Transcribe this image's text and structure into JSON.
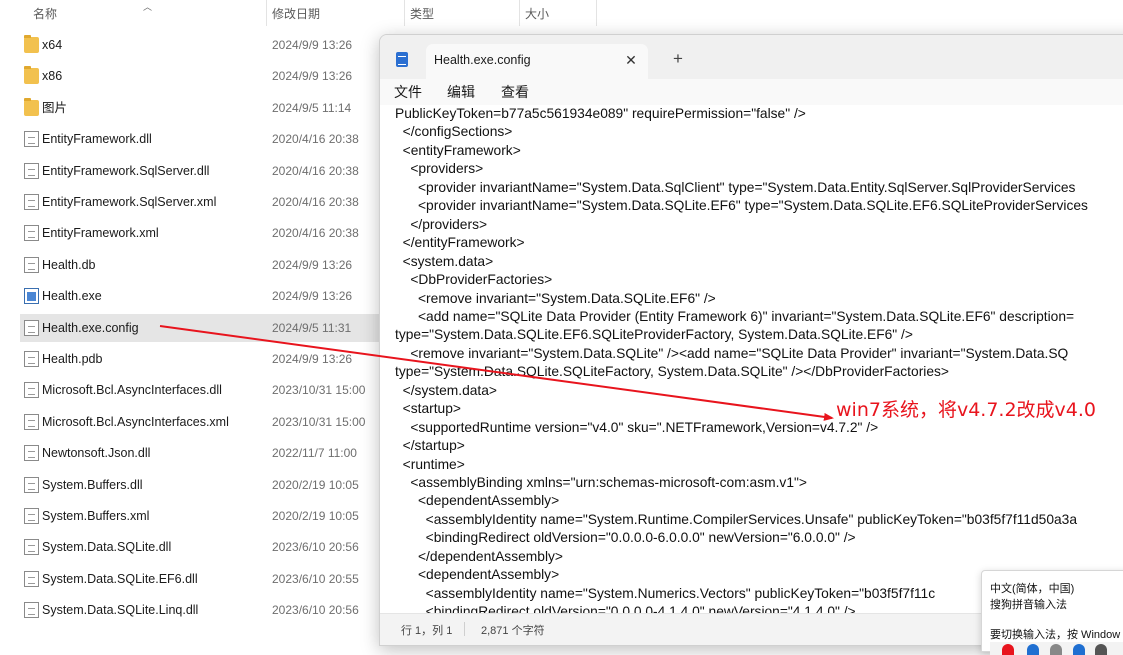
{
  "explorer": {
    "columns": {
      "name": "名称",
      "modified": "修改日期",
      "type": "类型",
      "size": "大小"
    },
    "files": [
      {
        "name": "x64",
        "date": "2024/9/9 13:26",
        "kind": "folder"
      },
      {
        "name": "x86",
        "date": "2024/9/9 13:26",
        "kind": "folder"
      },
      {
        "name": "图片",
        "date": "2024/9/5 11:14",
        "kind": "folder"
      },
      {
        "name": "EntityFramework.dll",
        "date": "2020/4/16 20:38",
        "kind": "file"
      },
      {
        "name": "EntityFramework.SqlServer.dll",
        "date": "2020/4/16 20:38",
        "kind": "file"
      },
      {
        "name": "EntityFramework.SqlServer.xml",
        "date": "2020/4/16 20:38",
        "kind": "file"
      },
      {
        "name": "EntityFramework.xml",
        "date": "2020/4/16 20:38",
        "kind": "file"
      },
      {
        "name": "Health.db",
        "date": "2024/9/9 13:26",
        "kind": "file"
      },
      {
        "name": "Health.exe",
        "date": "2024/9/9 13:26",
        "kind": "exe"
      },
      {
        "name": "Health.exe.config",
        "date": "2024/9/5 11:31",
        "kind": "file",
        "selected": true
      },
      {
        "name": "Health.pdb",
        "date": "2024/9/9 13:26",
        "kind": "file"
      },
      {
        "name": "Microsoft.Bcl.AsyncInterfaces.dll",
        "date": "2023/10/31 15:00",
        "kind": "file"
      },
      {
        "name": "Microsoft.Bcl.AsyncInterfaces.xml",
        "date": "2023/10/31 15:00",
        "kind": "file"
      },
      {
        "name": "Newtonsoft.Json.dll",
        "date": "2022/11/7 11:00",
        "kind": "file"
      },
      {
        "name": "System.Buffers.dll",
        "date": "2020/2/19 10:05",
        "kind": "file"
      },
      {
        "name": "System.Buffers.xml",
        "date": "2020/2/19 10:05",
        "kind": "file"
      },
      {
        "name": "System.Data.SQLite.dll",
        "date": "2023/6/10 20:56",
        "kind": "file"
      },
      {
        "name": "System.Data.SQLite.EF6.dll",
        "date": "2023/6/10 20:55",
        "kind": "file"
      },
      {
        "name": "System.Data.SQLite.Linq.dll",
        "date": "2023/6/10 20:56",
        "kind": "file"
      }
    ]
  },
  "notepad": {
    "tab_title": "Health.exe.config",
    "close_glyph": "✕",
    "new_tab_glyph": "+",
    "menu": {
      "file": "文件",
      "edit": "编辑",
      "view": "查看"
    },
    "lines": [
      "PublicKeyToken=b77a5c561934e089\" requirePermission=\"false\" />",
      "  </configSections>",
      "  <entityFramework>",
      "    <providers>",
      "      <provider invariantName=\"System.Data.SqlClient\" type=\"System.Data.Entity.SqlServer.SqlProviderServices",
      "      <provider invariantName=\"System.Data.SQLite.EF6\" type=\"System.Data.SQLite.EF6.SQLiteProviderServices",
      "    </providers>",
      "  </entityFramework>",
      "  <system.data>",
      "    <DbProviderFactories>",
      "      <remove invariant=\"System.Data.SQLite.EF6\" />",
      "      <add name=\"SQLite Data Provider (Entity Framework 6)\" invariant=\"System.Data.SQLite.EF6\" description=",
      "type=\"System.Data.SQLite.EF6.SQLiteProviderFactory, System.Data.SQLite.EF6\" />",
      "    <remove invariant=\"System.Data.SQLite\" /><add name=\"SQLite Data Provider\" invariant=\"System.Data.SQ",
      "type=\"System.Data.SQLite.SQLiteFactory, System.Data.SQLite\" /></DbProviderFactories>",
      "  </system.data>",
      "  <startup>",
      "    <supportedRuntime version=\"v4.0\" sku=\".NETFramework,Version=v4.7.2\" />",
      "  </startup>",
      "  <runtime>",
      "    <assemblyBinding xmlns=\"urn:schemas-microsoft-com:asm.v1\">",
      "      <dependentAssembly>",
      "        <assemblyIdentity name=\"System.Runtime.CompilerServices.Unsafe\" publicKeyToken=\"b03f5f7f11d50a3a",
      "        <bindingRedirect oldVersion=\"0.0.0.0-6.0.0.0\" newVersion=\"6.0.0.0\" />",
      "      </dependentAssembly>",
      "      <dependentAssembly>",
      "        <assemblyIdentity name=\"System.Numerics.Vectors\" publicKeyToken=\"b03f5f7f11c",
      "        <bindingRedirect oldVersion=\"0.0.0.0-4.1.4.0\" newVersion=\"4.1.4.0\" />"
    ],
    "status": {
      "position": "行 1，列 1",
      "chars": "2,871 个字符"
    }
  },
  "annotation": {
    "text": "win7系统，将v4.7.2改成v4.0",
    "color": "#e8141d"
  },
  "ime": {
    "line1": "中文(简体，中国)",
    "line2": "搜狗拼音输入法",
    "line3": "要切换输入法，按 Window"
  },
  "colors": {
    "selection": "#e5e5e5",
    "accent_red": "#e8141d",
    "notepad_icon": "#2b6fd1"
  }
}
